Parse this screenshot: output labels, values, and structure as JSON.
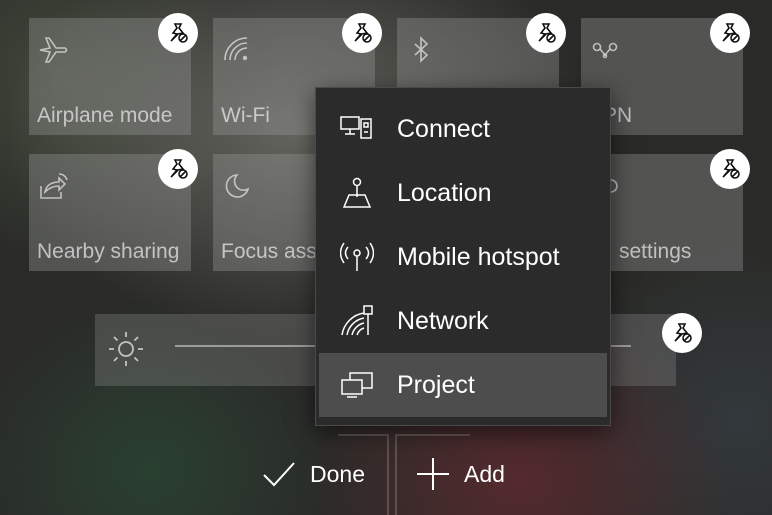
{
  "tiles": [
    {
      "label": "Airplane mode",
      "icon": "airplane-icon"
    },
    {
      "label": "Wi-Fi",
      "icon": "wifi-icon"
    },
    {
      "label": "",
      "icon": "bluetooth-icon"
    },
    {
      "label": "PN",
      "icon": "vpn-icon"
    },
    {
      "label": "Nearby sharing",
      "icon": "nearby-sharing-icon"
    },
    {
      "label": "Focus ass",
      "icon": "moon-icon"
    },
    {
      "label": "",
      "icon": "blank"
    },
    {
      "label": "settings",
      "icon": "settings-icon"
    }
  ],
  "menu": {
    "items": [
      {
        "label": "Connect",
        "icon": "connect-icon"
      },
      {
        "label": "Location",
        "icon": "location-icon"
      },
      {
        "label": "Mobile hotspot",
        "icon": "mobile-hotspot-icon"
      },
      {
        "label": "Network",
        "icon": "network-icon"
      },
      {
        "label": "Project",
        "icon": "project-icon"
      }
    ],
    "selected": "Project"
  },
  "actions": {
    "done_label": "Done",
    "add_label": "Add"
  },
  "colors": {
    "menu_bg": "#2b2b2b",
    "menu_selected": "#4d4d4d",
    "pin_bg": "#ffffff"
  }
}
